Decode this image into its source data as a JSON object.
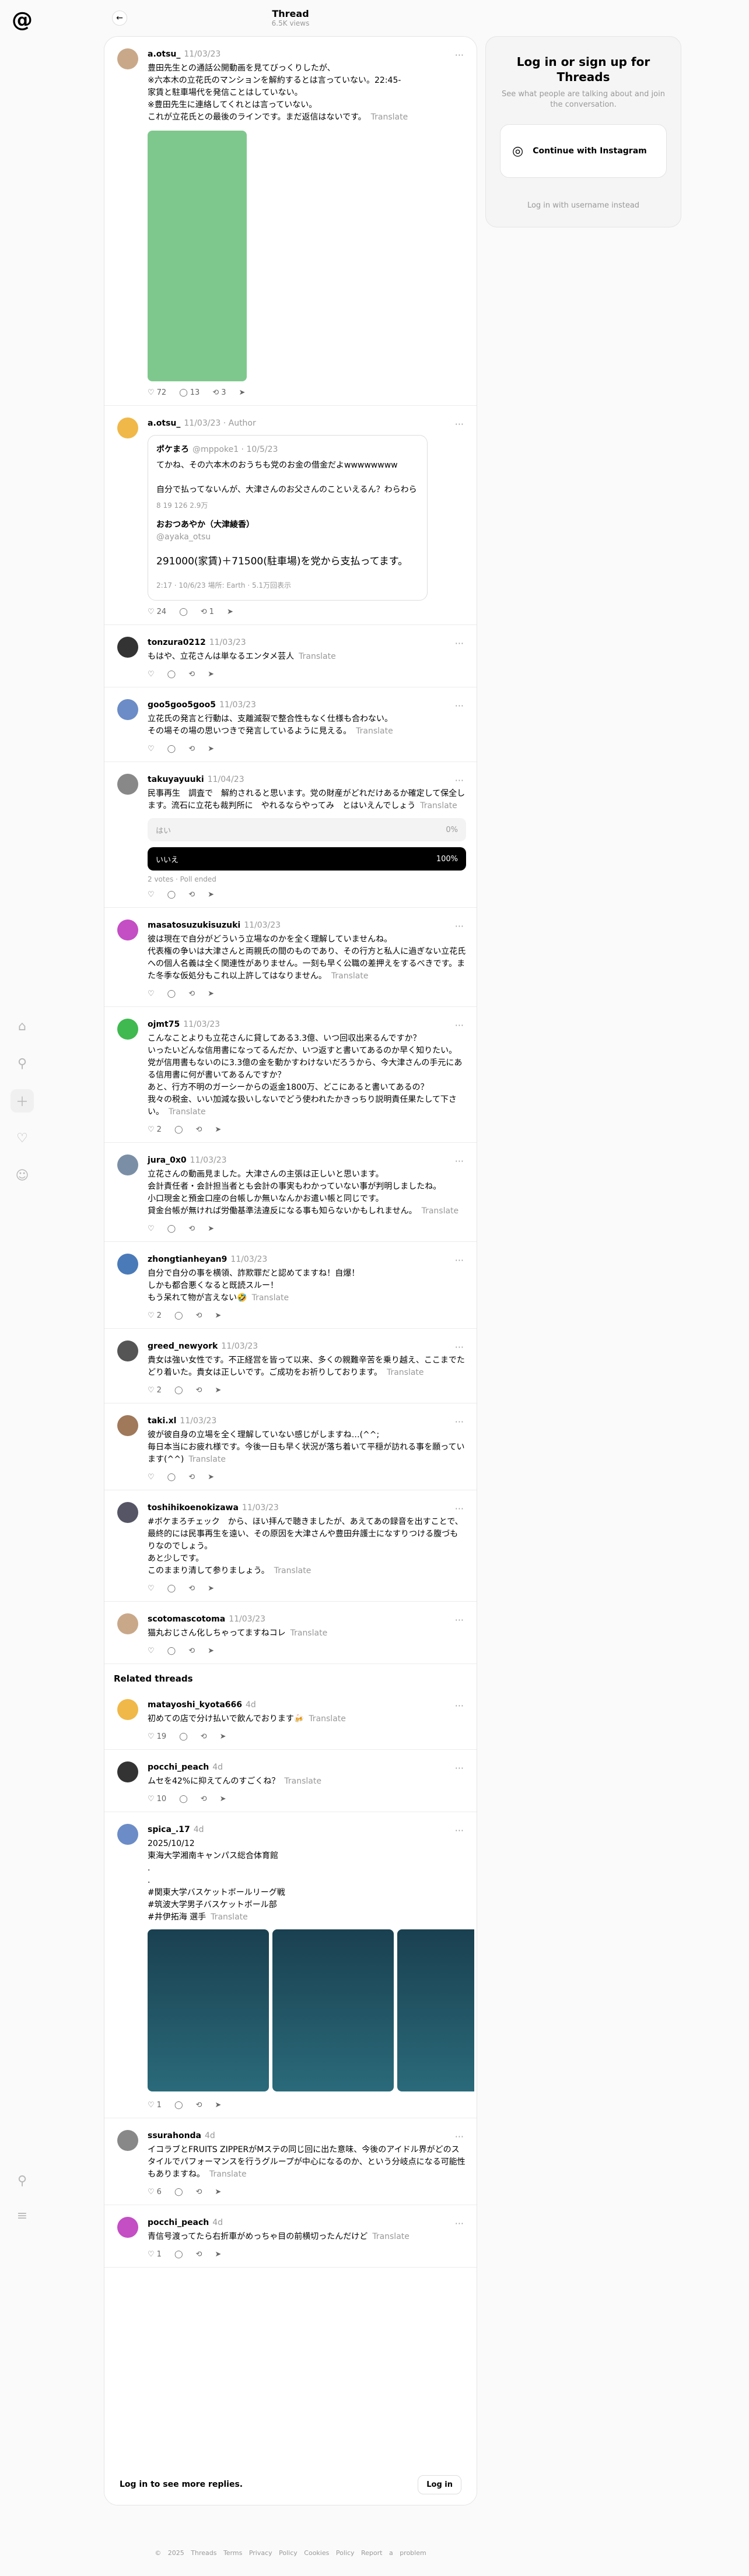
{
  "header": {
    "title": "Thread",
    "views": "6.5K views"
  },
  "posts": [
    {
      "user": "a.otsu_",
      "time": "11/03/23",
      "body": "豊田先生との通話公開動画を見てびっくりしたが、\n※六本木の立花氏のマンションを解約するとは言っていない。22:45-\n家賃と駐車場代を発信ことはしていない。\n※豊田先生に連絡してくれとは言っていない。\nこれが立花氏との最後のラインです。まだ返信はないです。",
      "translate": "Translate",
      "likes": "72",
      "replies": "13",
      "reposts": "3"
    },
    {
      "user": "a.otsu_",
      "time": "11/03/23 · Author",
      "q_name": "ポケまろ",
      "q_handle": "@mppoke1 · 10/5/23",
      "q_body": "てかね、その六本木のおうちも党のお金の借金だよwwwwwwww\n\n自分で払ってないんが、大津さんのお父さんのこといえるん？わらわら",
      "q_stats": "8  19  126  2.9万",
      "q2_name": "おおつあやか（大津綾香）",
      "q2_handle": "@ayaka_otsu",
      "q2_body": "291000(家賃)＋71500(駐車場)を党から支払ってます。",
      "q2_meta": "2:17 · 10/6/23 場所: Earth · 5.1万回表示",
      "likes": "24",
      "replies": "",
      "reposts": "1"
    },
    {
      "user": "tonzura0212",
      "time": "11/03/23",
      "body": "もはや、立花さんは単なるエンタメ芸人",
      "translate": "Translate"
    },
    {
      "user": "goo5goo5goo5",
      "time": "11/03/23",
      "body": "立花氏の発言と行動は、支離滅裂で整合性もなく仕様も合わない。\nその場その場の思いつきで発言しているように見える。",
      "translate": "Translate"
    },
    {
      "user": "takuyayuuki",
      "time": "11/04/23",
      "body": "民事再生　調査で　解約されると思います。党の財産がどれだけあるか確定して保全します。流石に立花も裁判所に　やれるならやってみ　とはいえんでしょう",
      "translate": "Translate",
      "poll": [
        {
          "label": "はい",
          "pct": "0%"
        },
        {
          "label": "いいえ",
          "pct": "100%"
        }
      ],
      "votes": "2 votes · Poll ended"
    },
    {
      "user": "masatosuzukisuzuki",
      "time": "11/03/23",
      "body": "彼は現在で自分がどういう立場なのかを全く理解していませんね。\n代表権の争いは大津さんと両親氏の間のものであり、その行方と私人に過ぎない立花氏への個人名義は全く関連性がありません。一刻も早く公職の差押えをするべきです。また冬季な仮処分もこれ以上許してはなりません。",
      "translate": "Translate"
    },
    {
      "user": "ojmt75",
      "time": "11/03/23",
      "body": "こんなことよりも立花さんに貸してある3.3億、いつ回収出来るんですか？\nいったいどんな信用書になってるんだか、いつ返すと書いてあるのか早く知りたい。\n党が信用書もないのに3.3億の金を動かすわけないだろうから、今大津さんの手元にある信用書に何が書いてあるんですか？\nあと、行方不明のガーシーからの返金1800万、どこにあると書いてあるの？\n我々の税金、いい加減な扱いしないでどう使われたかきっちり説明責任果たして下さい。",
      "translate": "Translate",
      "likes": "2"
    },
    {
      "user": "jura_0x0",
      "time": "11/03/23",
      "body": "立花さんの動画見ました。大津さんの主張は正しいと思います。\n会計責任者・会計担当者とも会計の事実もわかっていない事が判明しましたね。\n小口現金と預金口座の台帳しか無いなんかお遣い帳と同じです。\n貸金台帳が無ければ労働基準法違反になる事も知らないかもしれません。",
      "translate": "Translate"
    },
    {
      "user": "zhongtianheyan9",
      "time": "11/03/23",
      "body": "自分で自分の事を横領、詐欺罪だと認めてますね！自爆！\nしかも都合悪くなると既読スルー！\nもう呆れて物が言えない🤣",
      "translate": "Translate",
      "likes": "2"
    },
    {
      "user": "greed_newyork",
      "time": "11/03/23",
      "body": "貴女は強い女性です。不正経営を皆って以来、多くの親難辛苦を乗り越え、ここまでたどり着いた。貴女は正しいです。ご成功をお祈りしております。",
      "translate": "Translate",
      "likes": "2"
    },
    {
      "user": "taki.xl",
      "time": "11/03/23",
      "body": "彼が彼自身の立場を全く理解していない感じがしますね…(^^;\n毎日本当にお疲れ様です。今後一日も早く状況が落ち着いて平穏が訪れる事を願っています(^^)",
      "translate": "Translate"
    },
    {
      "user": "toshihikoenokizawa",
      "time": "11/03/23",
      "body": "#ボケまろチェック　から、ほい拝んで聴きましたが、あえてあの録音を出すことで、最終的には民事再生を遠い、その原因を大津さんや豊田弁護士になすりつける腹づもりなのでしょう。\nあと少しです。\nこのままり清して参りましょう。",
      "translate": "Translate"
    },
    {
      "user": "scotomascotoma",
      "time": "11/03/23",
      "body": "猫丸おじさん化しちゃってますねコレ",
      "translate": "Translate"
    }
  ],
  "related_title": "Related threads",
  "related": [
    {
      "user": "matayoshi_kyota666",
      "time": "4d",
      "body": "初めての店で分け払いで飲んでおります🍻",
      "translate": "Translate",
      "likes": "19"
    },
    {
      "user": "pocchi_peach",
      "time": "4d",
      "body": "ムセを42%に抑えてんのすごくね？",
      "translate": "Translate",
      "likes": "10"
    },
    {
      "user": "spica_.17",
      "time": "4d",
      "body": "2025/10/12\n東海大学湘南キャンパス総合体育館\n.\n.\n#関東大学バスケットボールリーグ戦\n#筑波大学男子バスケットボール部\n#井伊拓海 選手",
      "translate": "Translate",
      "likes": "1"
    },
    {
      "user": "ssurahonda",
      "time": "4d",
      "body": "イコラブとFRUITS ZIPPERがMステの同じ回に出た意味、今後のアイドル界がどのスタイルでパフォーマンスを行うグループが中心になるのか、という分岐点になる可能性もありますね。",
      "translate": "Translate",
      "likes": "6"
    },
    {
      "user": "pocchi_peach",
      "time": "4d",
      "body": "青信号渡ってたら右折車がめっちゃ目の前横切ったんだけど",
      "translate": "Translate",
      "likes": "1"
    }
  ],
  "more_replies": "Log in to see more replies.",
  "login_btn": "Log in",
  "login": {
    "title": "Log in or sign up for Threads",
    "sub": "See what people are talking about and join the conversation.",
    "ig": "Continue with Instagram",
    "user": "Log in with username instead"
  },
  "footer": "© 2025  Threads Terms  Privacy Policy  Cookies Policy  Report a problem"
}
